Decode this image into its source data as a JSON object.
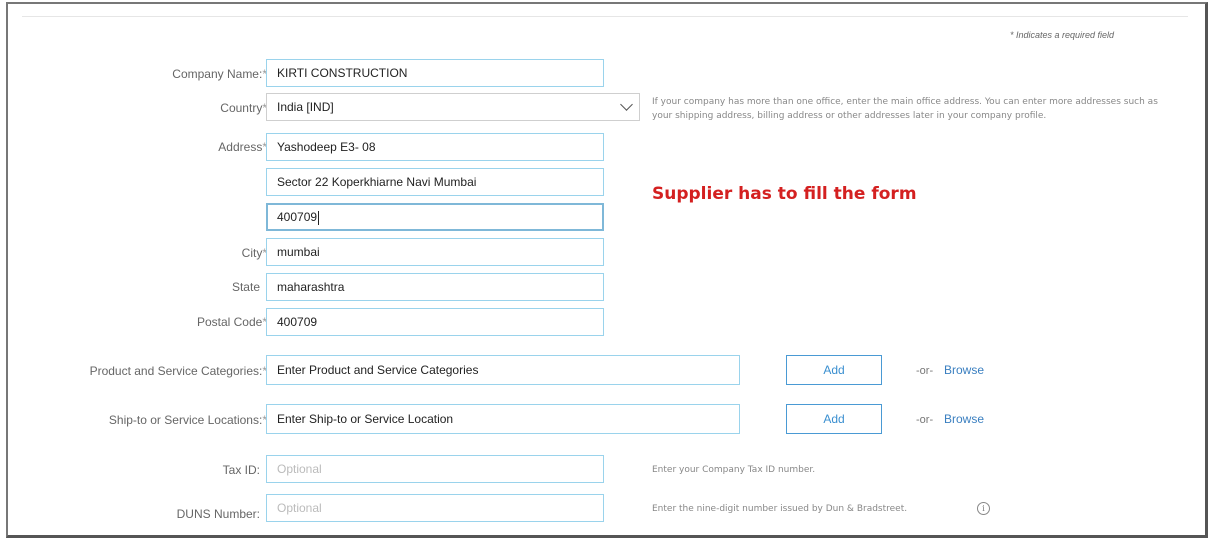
{
  "required_note": "* Indicates a required field",
  "banner": "Supplier has to fill the form",
  "labels": {
    "company_name": "Company Name:",
    "country": "Country",
    "address": "Address",
    "city": "City",
    "state": "State",
    "postal_code": "Postal Code",
    "categories": "Product and Service Categories:",
    "locations": "Ship-to or Service Locations:",
    "tax_id": "Tax ID:",
    "duns": "DUNS Number:"
  },
  "required_marker": "*",
  "values": {
    "company_name": "KIRTI CONSTRUCTION",
    "country": "India [IND]",
    "address_line1": "Yashodeep E3- 08",
    "address_line2": "Sector 22 Koperkhiarne Navi Mumbai",
    "address_line3": "400709",
    "city": "mumbai",
    "state": "maharashtra",
    "postal_code": "400709"
  },
  "placeholders": {
    "categories": "Enter Product and Service Categories",
    "locations": "Enter Ship-to or Service Location",
    "tax_id": "Optional",
    "duns": "Optional"
  },
  "help": {
    "address": "If your company has more than one office, enter the main office address. You can enter more addresses such as your shipping address, billing address or other addresses later in your company profile.",
    "tax_id": "Enter your Company Tax ID number.",
    "duns": "Enter the nine-digit number issued by Dun & Bradstreet."
  },
  "buttons": {
    "add": "Add",
    "or": "-or-",
    "browse": "Browse"
  },
  "icons": {
    "country_dropdown": "chevron-down-icon",
    "duns_info": "info-icon"
  }
}
